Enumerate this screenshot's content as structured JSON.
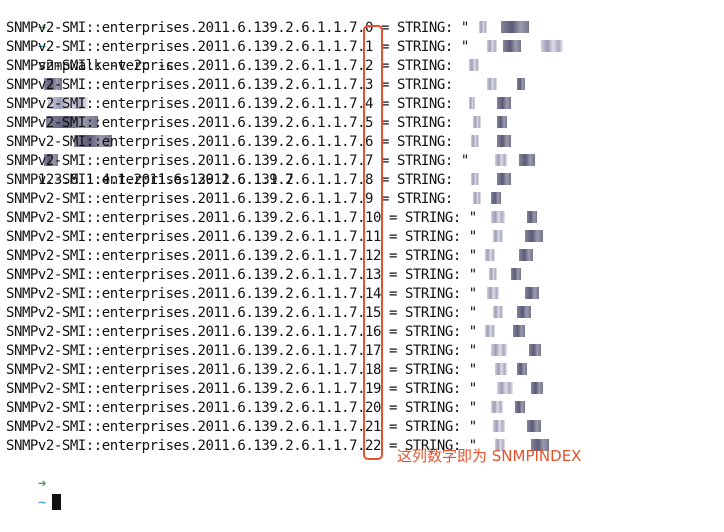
{
  "terminal": {
    "prompt_arrow": "➜",
    "prompt_dir": "~",
    "command": "snmpwalk -v 2c -c",
    "oid_arg": "1.3.6.1.4.1.2011.6.139.2.6.1.1.7",
    "rows": [
      {
        "prefix": "SNMPv2-SMI::enterprises.2011.6.139.2.6.1.1.7.",
        "index": "0",
        "sep": " = STRING: ",
        "value": "\""
      },
      {
        "prefix": "SNMPv2-SMI::enterprises.2011.6.139.2.6.1.1.7.",
        "index": "1",
        "sep": " = STRING: ",
        "value": "\""
      },
      {
        "prefix": "SNMPv2-SMI::enterprises.2011.6.139.2.6.1.1.7.",
        "index": "2",
        "sep": " = STRING: ",
        "value": ""
      },
      {
        "prefix": "SNMPv2-SMI::enterprises.2011.6.139.2.6.1.1.7.",
        "index": "3",
        "sep": " = STRING: ",
        "value": ""
      },
      {
        "prefix": "SNMPv2-SMI::enterprises.2011.6.139.2.6.1.1.7.",
        "index": "4",
        "sep": " = STRING: ",
        "value": ""
      },
      {
        "prefix": "SNMPv2-SMI::enterprises.2011.6.139.2.6.1.1.7.",
        "index": "5",
        "sep": " = STRING: ",
        "value": ""
      },
      {
        "prefix": "SNMPv2-SMI::enterprises.2011.6.139.2.6.1.1.7.",
        "index": "6",
        "sep": " = STRING: ",
        "value": ""
      },
      {
        "prefix": "SNMPv2-SMI::enterprises.2011.6.139.2.6.1.1.7.",
        "index": "7",
        "sep": " = STRING: ",
        "value": "\""
      },
      {
        "prefix": "SNMPv2-SMI::enterprises.2011.6.139.2.6.1.1.7.",
        "index": "8",
        "sep": " = STRING: ",
        "value": ""
      },
      {
        "prefix": "SNMPv2-SMI::enterprises.2011.6.139.2.6.1.1.7.",
        "index": "9",
        "sep": " = STRING: ",
        "value": ""
      },
      {
        "prefix": "SNMPv2-SMI::enterprises.2011.6.139.2.6.1.1.7.",
        "index": "10",
        "sep": " = STRING: ",
        "value": "\""
      },
      {
        "prefix": "SNMPv2-SMI::enterprises.2011.6.139.2.6.1.1.7.",
        "index": "11",
        "sep": " = STRING: ",
        "value": "\""
      },
      {
        "prefix": "SNMPv2-SMI::enterprises.2011.6.139.2.6.1.1.7.",
        "index": "12",
        "sep": " = STRING: ",
        "value": "\""
      },
      {
        "prefix": "SNMPv2-SMI::enterprises.2011.6.139.2.6.1.1.7.",
        "index": "13",
        "sep": " = STRING: ",
        "value": "\""
      },
      {
        "prefix": "SNMPv2-SMI::enterprises.2011.6.139.2.6.1.1.7.",
        "index": "14",
        "sep": " = STRING: ",
        "value": "\""
      },
      {
        "prefix": "SNMPv2-SMI::enterprises.2011.6.139.2.6.1.1.7.",
        "index": "15",
        "sep": " = STRING: ",
        "value": "\""
      },
      {
        "prefix": "SNMPv2-SMI::enterprises.2011.6.139.2.6.1.1.7.",
        "index": "16",
        "sep": " = STRING: ",
        "value": "\""
      },
      {
        "prefix": "SNMPv2-SMI::enterprises.2011.6.139.2.6.1.1.7.",
        "index": "17",
        "sep": " = STRING: ",
        "value": "\""
      },
      {
        "prefix": "SNMPv2-SMI::enterprises.2011.6.139.2.6.1.1.7.",
        "index": "18",
        "sep": " = STRING: ",
        "value": "\""
      },
      {
        "prefix": "SNMPv2-SMI::enterprises.2011.6.139.2.6.1.1.7.",
        "index": "19",
        "sep": " = STRING: ",
        "value": "\""
      },
      {
        "prefix": "SNMPv2-SMI::enterprises.2011.6.139.2.6.1.1.7.",
        "index": "20",
        "sep": " = STRING: ",
        "value": "\""
      },
      {
        "prefix": "SNMPv2-SMI::enterprises.2011.6.139.2.6.1.1.7.",
        "index": "21",
        "sep": " = STRING: ",
        "value": "\""
      },
      {
        "prefix": "SNMPv2-SMI::enterprises.2011.6.139.2.6.1.1.7.",
        "index": "22",
        "sep": " = STRING: ",
        "value": "\""
      }
    ]
  },
  "annotation": {
    "text": "这列数字即为 SNMPINDEX",
    "color": "#e4532b"
  },
  "colors": {
    "prompt_arrow": "#39a83b",
    "prompt_dir": "#2a9ad1",
    "highlight": "#e4532b"
  }
}
